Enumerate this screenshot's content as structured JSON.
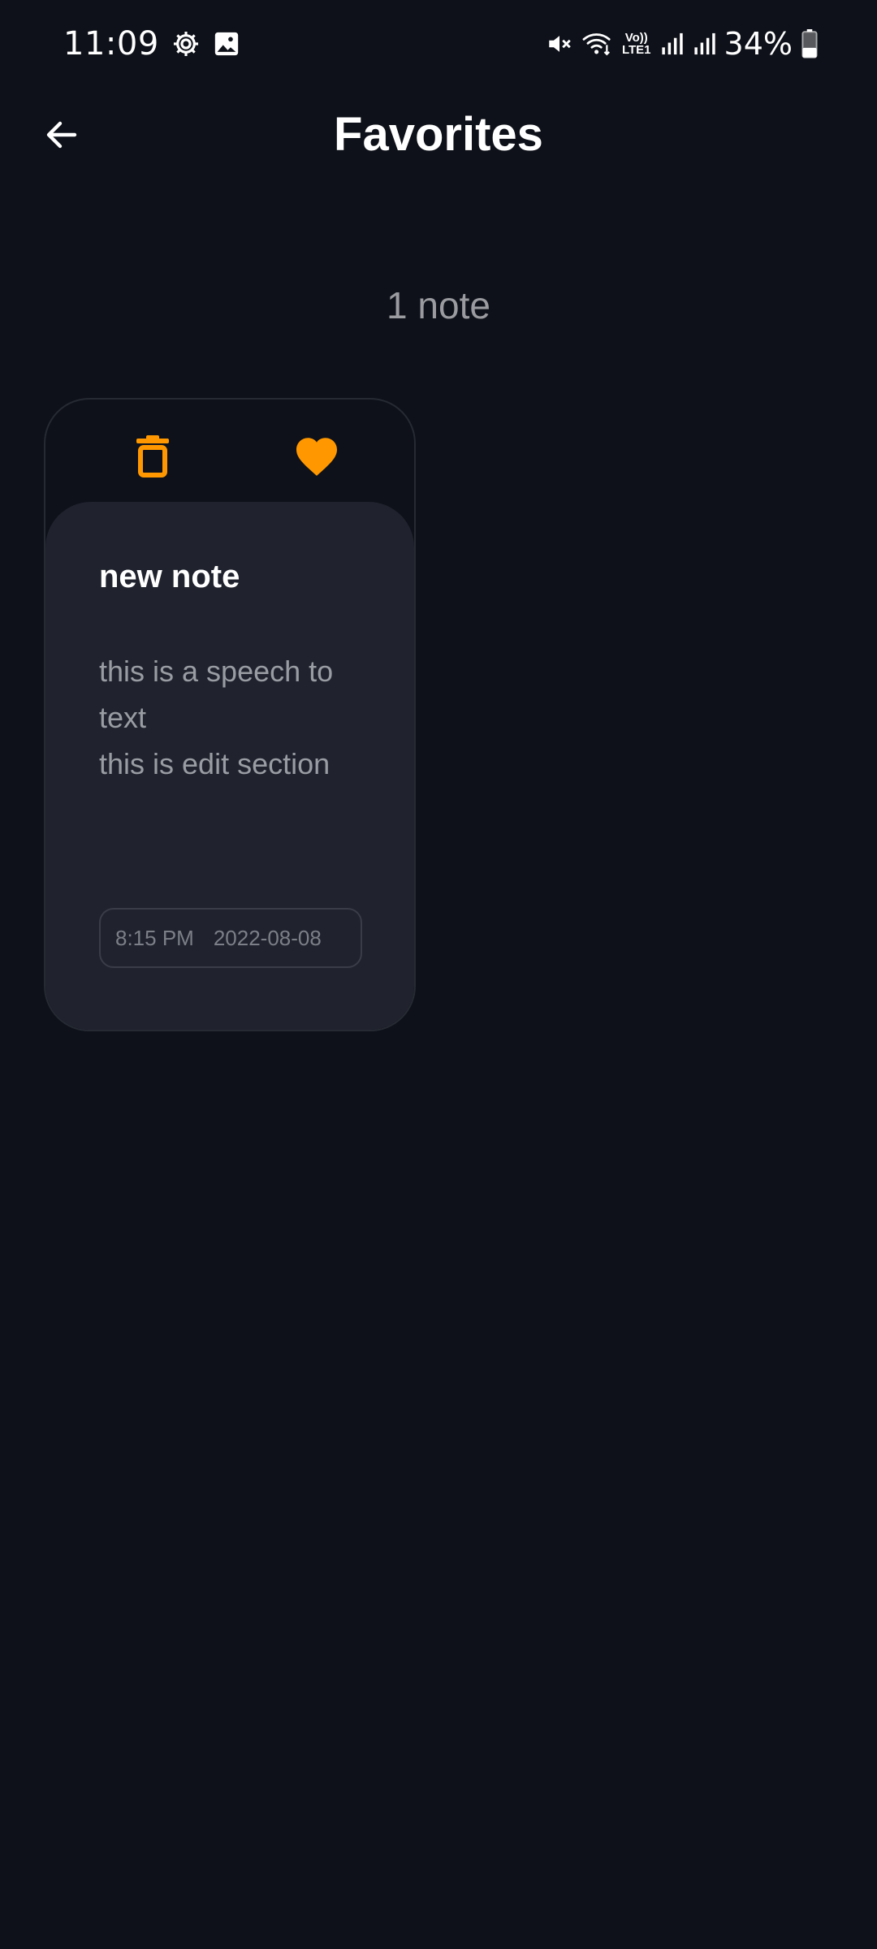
{
  "status_bar": {
    "time": "11:09",
    "battery": "34%",
    "icons_left": [
      "settings-icon",
      "gallery-icon"
    ],
    "icons_right": [
      "mute-icon",
      "wifi-icon",
      "volte-icon",
      "signal-icon",
      "signal-icon",
      "battery-icon"
    ],
    "volte_label_top": "Vo))",
    "volte_label_bottom": "LTE1"
  },
  "app_bar": {
    "title": "Favorites",
    "back_icon": "arrow-back-icon"
  },
  "main": {
    "note_count": "1 note",
    "notes": [
      {
        "title": "new note",
        "content": "this is a speech to text\nthis is edit section",
        "time": "8:15 PM",
        "date": "2022-08-08",
        "favorite": true,
        "actions": [
          "delete-icon",
          "heart-icon"
        ]
      }
    ]
  },
  "colors": {
    "background": "#0e1119",
    "card_body": "#20232e",
    "accent": "#ff9800",
    "text_primary": "#ffffff",
    "text_secondary": "#9a9ca3"
  }
}
